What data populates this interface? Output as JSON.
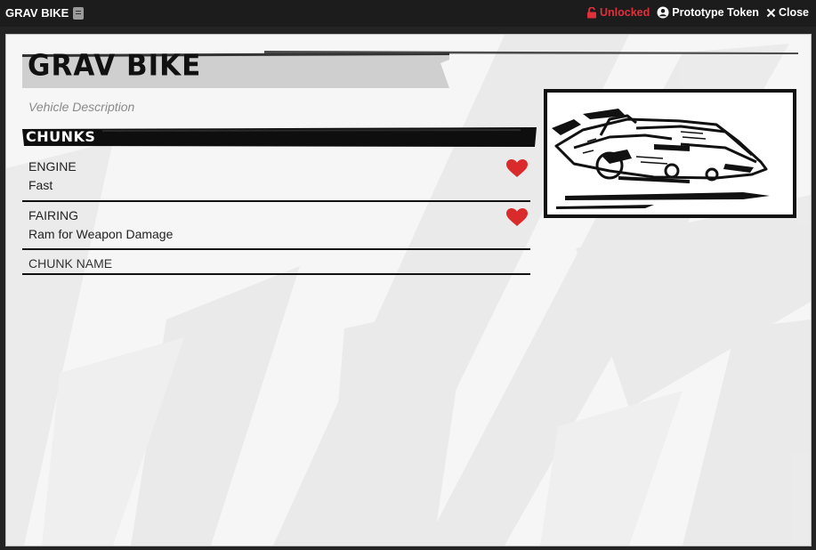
{
  "window": {
    "title": "GRAV BIKE",
    "title_icon": "document-icon"
  },
  "header": {
    "unlocked_label": "Unlocked",
    "prototype_label": "Prototype Token",
    "close_label": "Close",
    "unlocked_color": "#e0313b"
  },
  "sheet": {
    "name": "GRAV BIKE",
    "description_placeholder": "Vehicle Description",
    "chunks_heading": "CHUNKS",
    "chunks": [
      {
        "name": "ENGINE",
        "description": "Fast",
        "heart": true
      },
      {
        "name": "FAIRING",
        "description": "Ram for Weapon Damage",
        "heart": true
      },
      {
        "name": "CHUNK NAME",
        "description": "",
        "heart": false
      }
    ],
    "heart_color": "#d92b2b"
  }
}
